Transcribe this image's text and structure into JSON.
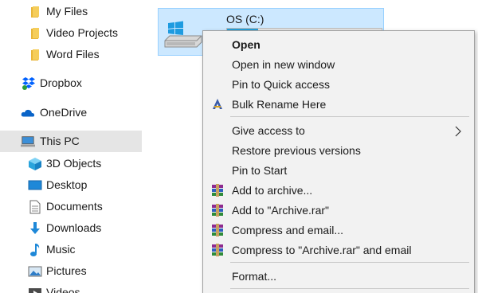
{
  "sidebar": {
    "items": [
      {
        "label": "My Files",
        "icon": "folder-icon"
      },
      {
        "label": "Video Projects",
        "icon": "folder-icon"
      },
      {
        "label": "Word Files",
        "icon": "folder-icon"
      },
      {
        "label": "Dropbox",
        "icon": "dropbox-icon"
      },
      {
        "label": "OneDrive",
        "icon": "onedrive-icon"
      },
      {
        "label": "This PC",
        "icon": "computer-icon",
        "selected": true
      },
      {
        "label": "3D Objects",
        "icon": "cube-icon"
      },
      {
        "label": "Desktop",
        "icon": "desktop-icon"
      },
      {
        "label": "Documents",
        "icon": "document-icon"
      },
      {
        "label": "Downloads",
        "icon": "download-icon"
      },
      {
        "label": "Music",
        "icon": "music-icon"
      },
      {
        "label": "Pictures",
        "icon": "pictures-icon"
      },
      {
        "label": "Videos",
        "icon": "video-icon"
      }
    ]
  },
  "main": {
    "drive": {
      "name": "OS (C:)",
      "usage_fraction": 0.2,
      "icon": "windows-drive-icon"
    }
  },
  "context_menu": {
    "items": [
      {
        "label": "Open",
        "bold": true
      },
      {
        "label": "Open in new window"
      },
      {
        "label": "Pin to Quick access"
      },
      {
        "label": "Bulk Rename Here",
        "icon": "bulk-rename-icon"
      },
      {
        "label": "Give access to",
        "submenu": true
      },
      {
        "label": "Restore previous versions"
      },
      {
        "label": "Pin to Start"
      },
      {
        "label": "Add to archive...",
        "icon": "winrar-icon"
      },
      {
        "label": "Add to \"Archive.rar\"",
        "icon": "winrar-icon"
      },
      {
        "label": "Compress and email...",
        "icon": "winrar-icon"
      },
      {
        "label": "Compress to \"Archive.rar\" and email",
        "icon": "winrar-icon"
      },
      {
        "label": "Format..."
      }
    ]
  },
  "colors": {
    "selection": "#cce8ff",
    "selection_border": "#99d1ff",
    "menu_bg": "#f2f2f2",
    "folder": "#f0c14b",
    "accent": "#0078d7"
  }
}
